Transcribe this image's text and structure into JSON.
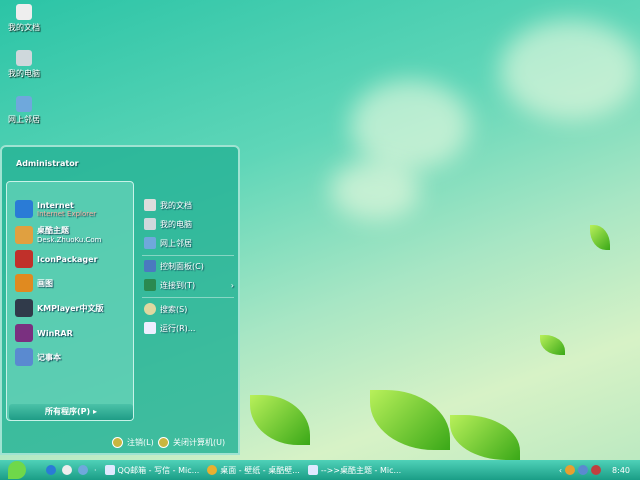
{
  "desktop": {
    "icons": [
      {
        "label": "我的文档"
      },
      {
        "label": "我的电脑"
      },
      {
        "label": "网上邻居"
      }
    ]
  },
  "start_menu": {
    "user": "Administrator",
    "pinned": [
      {
        "title": "Internet",
        "subtitle": "Internet Explorer",
        "color": "#2a7bd6"
      },
      {
        "title": "桌酷主题",
        "subtitle": "Desk.ZhuoKu.Com",
        "color": "#e0a040"
      },
      {
        "title": "IconPackager",
        "color": "#c0302a"
      },
      {
        "title": "画图",
        "color": "#e08a20"
      },
      {
        "title": "KMPlayer中文版",
        "color": "#303a4a"
      },
      {
        "title": "WinRAR",
        "color": "#7a3080"
      },
      {
        "title": "记事本",
        "color": "#5a8ad0"
      }
    ],
    "all_programs": "所有程序(P)",
    "right": [
      {
        "label": "我的文档"
      },
      {
        "label": "我的电脑"
      },
      {
        "label": "网上邻居"
      },
      {
        "label": "控制面板(C)"
      },
      {
        "label": "连接到(T)"
      },
      {
        "label": "搜索(S)"
      },
      {
        "label": "运行(R)..."
      }
    ],
    "logoff": "注销(L)",
    "shutdown": "关闭计算机(U)"
  },
  "taskbar": {
    "items": [
      "QQ邮箱 - 写信 - Mic...",
      "桌面 - 壁纸 - 桌酷壁...",
      "-->>桌酷主题 - Mic..."
    ],
    "clock": "8:40"
  }
}
